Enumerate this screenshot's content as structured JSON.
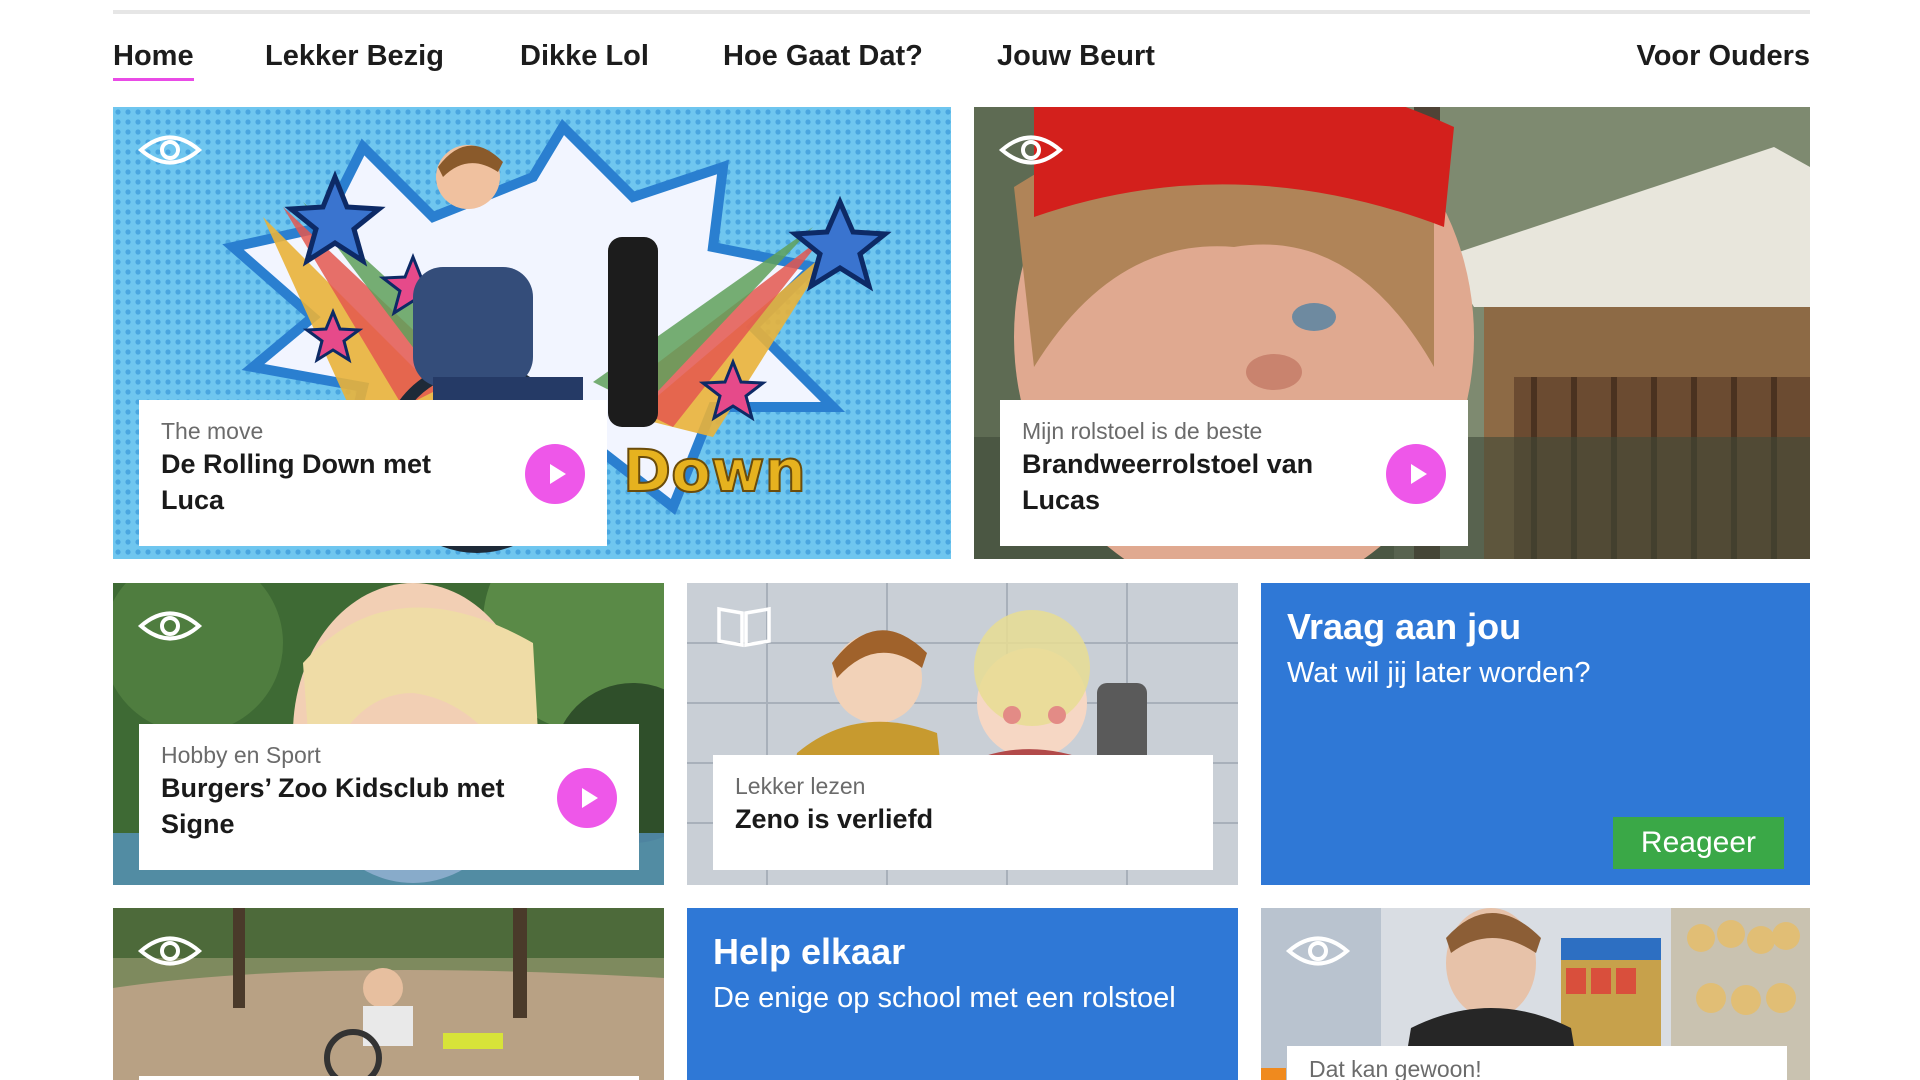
{
  "nav": {
    "items": [
      {
        "label": "Home",
        "active": true
      },
      {
        "label": "Lekker Bezig"
      },
      {
        "label": "Dikke Lol"
      },
      {
        "label": "Hoe Gaat Dat?"
      },
      {
        "label": "Jouw Beurt"
      }
    ],
    "parents_label": "Voor Ouders"
  },
  "tiles": {
    "rolling_down": {
      "kicker": "The move",
      "title": "De Rolling Down met Luca",
      "art_text": "Down",
      "icon": "eye-icon"
    },
    "brandweer": {
      "kicker": "Mijn rolstoel is de beste",
      "title": "Brandweerrolstoel van Lucas",
      "icon": "eye-icon"
    },
    "burgers_zoo": {
      "kicker": "Hobby en Sport",
      "title": "Burgers’ Zoo Kidsclub met Signe",
      "icon": "eye-icon"
    },
    "zeno": {
      "kicker": "Lekker lezen",
      "title": "Zeno is verliefd",
      "icon": "book-icon"
    },
    "vraag": {
      "heading": "Vraag aan jou",
      "sub": "Wat wil jij later worden?",
      "button": "Reageer"
    },
    "playground": {
      "icon": "eye-icon"
    },
    "help": {
      "heading": "Help elkaar",
      "sub": "De enige op school met een rolstoel"
    },
    "kan_gewoon": {
      "kicker": "Dat kan gewoon!",
      "icon": "eye-icon"
    }
  },
  "colors": {
    "accent_pink": "#ee57e9",
    "tile_blue": "#2f78d6",
    "button_green": "#3aa847"
  }
}
